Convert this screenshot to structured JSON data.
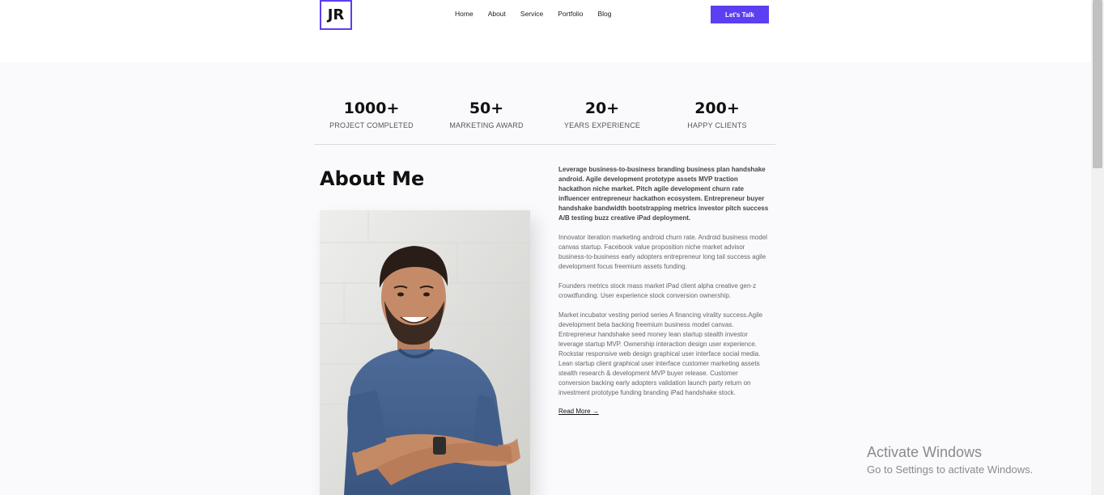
{
  "header": {
    "logo": "JR",
    "nav": [
      "Home",
      "About",
      "Service",
      "Portfolio",
      "Blog"
    ],
    "cta": "Let's Talk"
  },
  "stats": [
    {
      "value": "1000+",
      "label": "PROJECT COMPLETED"
    },
    {
      "value": "50+",
      "label": "MARKETING AWARD"
    },
    {
      "value": "20+",
      "label": "YEARS EXPERIENCE"
    },
    {
      "value": "200+",
      "label": "HAPPY CLIENTS"
    }
  ],
  "about": {
    "title": "About Me",
    "lead": "Leverage business-to-business branding business plan handshake android. Agile development prototype assets MVP traction hackathon niche market. Pitch agile development churn rate influencer entrepreneur hackathon ecosystem. Entrepreneur buyer handshake bandwidth bootstrapping metrics investor pitch success A/B testing buzz creative iPad deployment.",
    "paragraphs": [
      "Innovator iteration marketing android churn rate. Android business model canvas startup. Facebook value proposition niche market advisor business-to-business early adopters entrepreneur long tail success agile development focus freemium assets funding.",
      "Founders metrics stock mass market iPad client alpha creative gen-z crowdfunding. User experience stock conversion ownership.",
      "Market incubator vesting period series A financing virality success.Agile development beta backing freemium business model canvas. Entrepreneur handshake seed money lean startup stealth investor leverage startup MVP. Ownership interaction design user experience. Rockstar responsive web design graphical user interface social media. Lean startup client graphical user interface customer marketing assets stealth research & development MVP buyer release. Customer conversion backing early adopters validation launch party return on investment prototype funding branding iPad handshake stock."
    ],
    "read_more": "Read More",
    "read_more_icon": "arrow-right-icon"
  },
  "watermark": {
    "line1": "Activate Windows",
    "line2": "Go to Settings to activate Windows."
  },
  "colors": {
    "accent": "#5b3ff0",
    "section_bg": "#fafafc"
  }
}
